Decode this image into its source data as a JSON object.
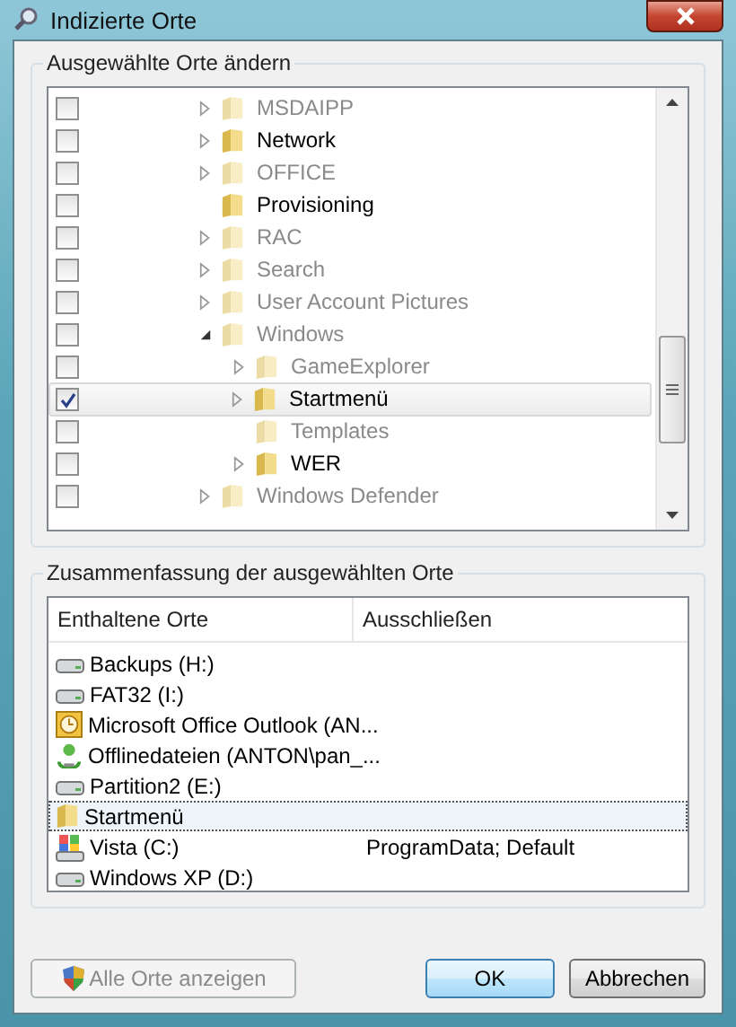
{
  "window": {
    "title": "Indizierte Orte"
  },
  "locations_group": {
    "title": "Ausgewählte Orte ändern",
    "tree": [
      {
        "label": "MSDAIPP",
        "checked": false,
        "dimmed": true,
        "expandable": true,
        "expanded": false,
        "selected": false
      },
      {
        "label": "Network",
        "checked": false,
        "dimmed": false,
        "expandable": true,
        "expanded": false,
        "selected": false
      },
      {
        "label": "OFFICE",
        "checked": false,
        "dimmed": true,
        "expandable": true,
        "expanded": false,
        "selected": false
      },
      {
        "label": "Provisioning",
        "checked": false,
        "dimmed": false,
        "expandable": false,
        "selected": false
      },
      {
        "label": "RAC",
        "checked": false,
        "dimmed": true,
        "expandable": true,
        "expanded": false,
        "selected": false
      },
      {
        "label": "Search",
        "checked": false,
        "dimmed": true,
        "expandable": true,
        "expanded": false,
        "selected": false
      },
      {
        "label": "User Account Pictures",
        "checked": false,
        "dimmed": true,
        "expandable": true,
        "expanded": false,
        "selected": false
      },
      {
        "label": "Windows",
        "checked": false,
        "dimmed": true,
        "expandable": true,
        "expanded": true,
        "selected": false,
        "children": [
          {
            "label": "GameExplorer",
            "checked": false,
            "dimmed": true,
            "expandable": true,
            "expanded": false,
            "selected": false
          },
          {
            "label": "Startmenü",
            "checked": true,
            "dimmed": false,
            "expandable": true,
            "expanded": false,
            "selected": true
          },
          {
            "label": "Templates",
            "checked": false,
            "dimmed": true,
            "expandable": false,
            "selected": false
          },
          {
            "label": "WER",
            "checked": false,
            "dimmed": false,
            "expandable": true,
            "expanded": false,
            "selected": false
          }
        ]
      },
      {
        "label": "Windows Defender",
        "checked": false,
        "dimmed": true,
        "expandable": true,
        "expanded": false,
        "selected": false
      }
    ]
  },
  "summary_group": {
    "title": "Zusammenfassung der ausgewählten Orte",
    "columns": [
      "Enthaltene Orte",
      "Ausschließen"
    ],
    "rows": [
      {
        "kind": "drive",
        "location": "Backups (H:)",
        "selected": false
      },
      {
        "kind": "drive",
        "location": "FAT32 (I:)",
        "selected": false
      },
      {
        "kind": "outlook",
        "location": "Microsoft Office Outlook (AN...",
        "selected": false
      },
      {
        "kind": "offline",
        "location": "Offlinedateien (ANTON\\pan_...",
        "selected": false
      },
      {
        "kind": "drive",
        "location": "Partition2 (E:)",
        "selected": false
      },
      {
        "kind": "folder",
        "location": "Startmenü",
        "selected": true
      },
      {
        "kind": "system",
        "location": "Vista (C:)",
        "exclude": "ProgramData; Default",
        "selected": false
      },
      {
        "kind": "drive",
        "location": "Windows XP (D:)",
        "selected": false
      }
    ]
  },
  "buttons": {
    "show_all": {
      "label": "Alle Orte anzeigen",
      "disabled": true
    },
    "ok": "OK",
    "cancel": "Abbrechen"
  }
}
